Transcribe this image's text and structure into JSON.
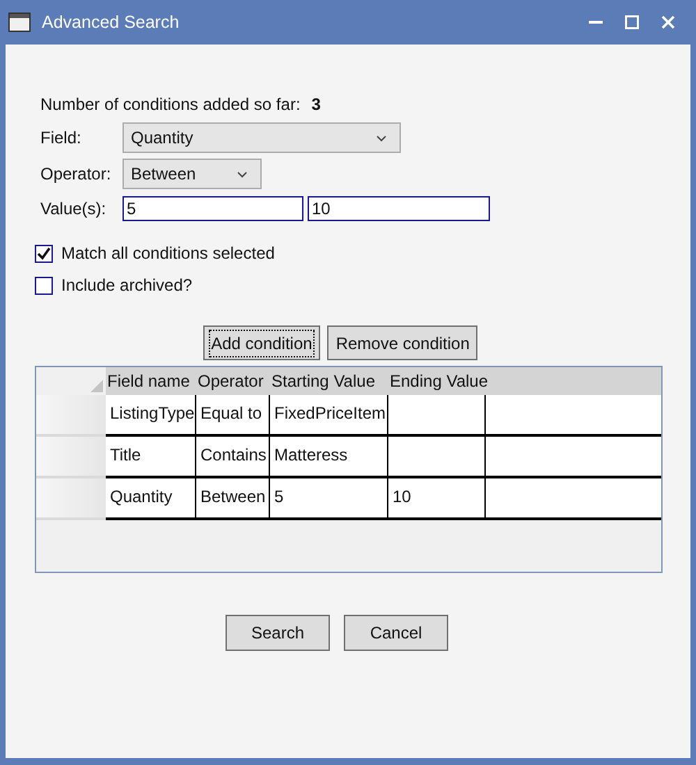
{
  "window": {
    "title": "Advanced Search"
  },
  "summary": {
    "label": "Number of conditions added so far:",
    "value": "3"
  },
  "field": {
    "label": "Field:",
    "value": "Quantity"
  },
  "operator": {
    "label": "Operator:",
    "value": "Between"
  },
  "values": {
    "label": "Value(s):",
    "start": "5",
    "end": "10"
  },
  "options": [
    {
      "label": "Match all conditions selected",
      "checked": true
    },
    {
      "label": "Include archived?",
      "checked": false
    }
  ],
  "condition_buttons": [
    {
      "label": "Add condition",
      "focused": true
    },
    {
      "label": "Remove condition",
      "focused": false
    }
  ],
  "table": {
    "columns": [
      "Field name",
      "Operator",
      "Starting Value",
      "Ending Value"
    ],
    "rows": [
      [
        "ListingType",
        "Equal to",
        "FixedPriceItem",
        ""
      ],
      [
        "Title",
        "Contains",
        "Matteress",
        ""
      ],
      [
        "Quantity",
        "Between",
        "5",
        "10"
      ]
    ]
  },
  "buttons": [
    "Search",
    "Cancel"
  ]
}
